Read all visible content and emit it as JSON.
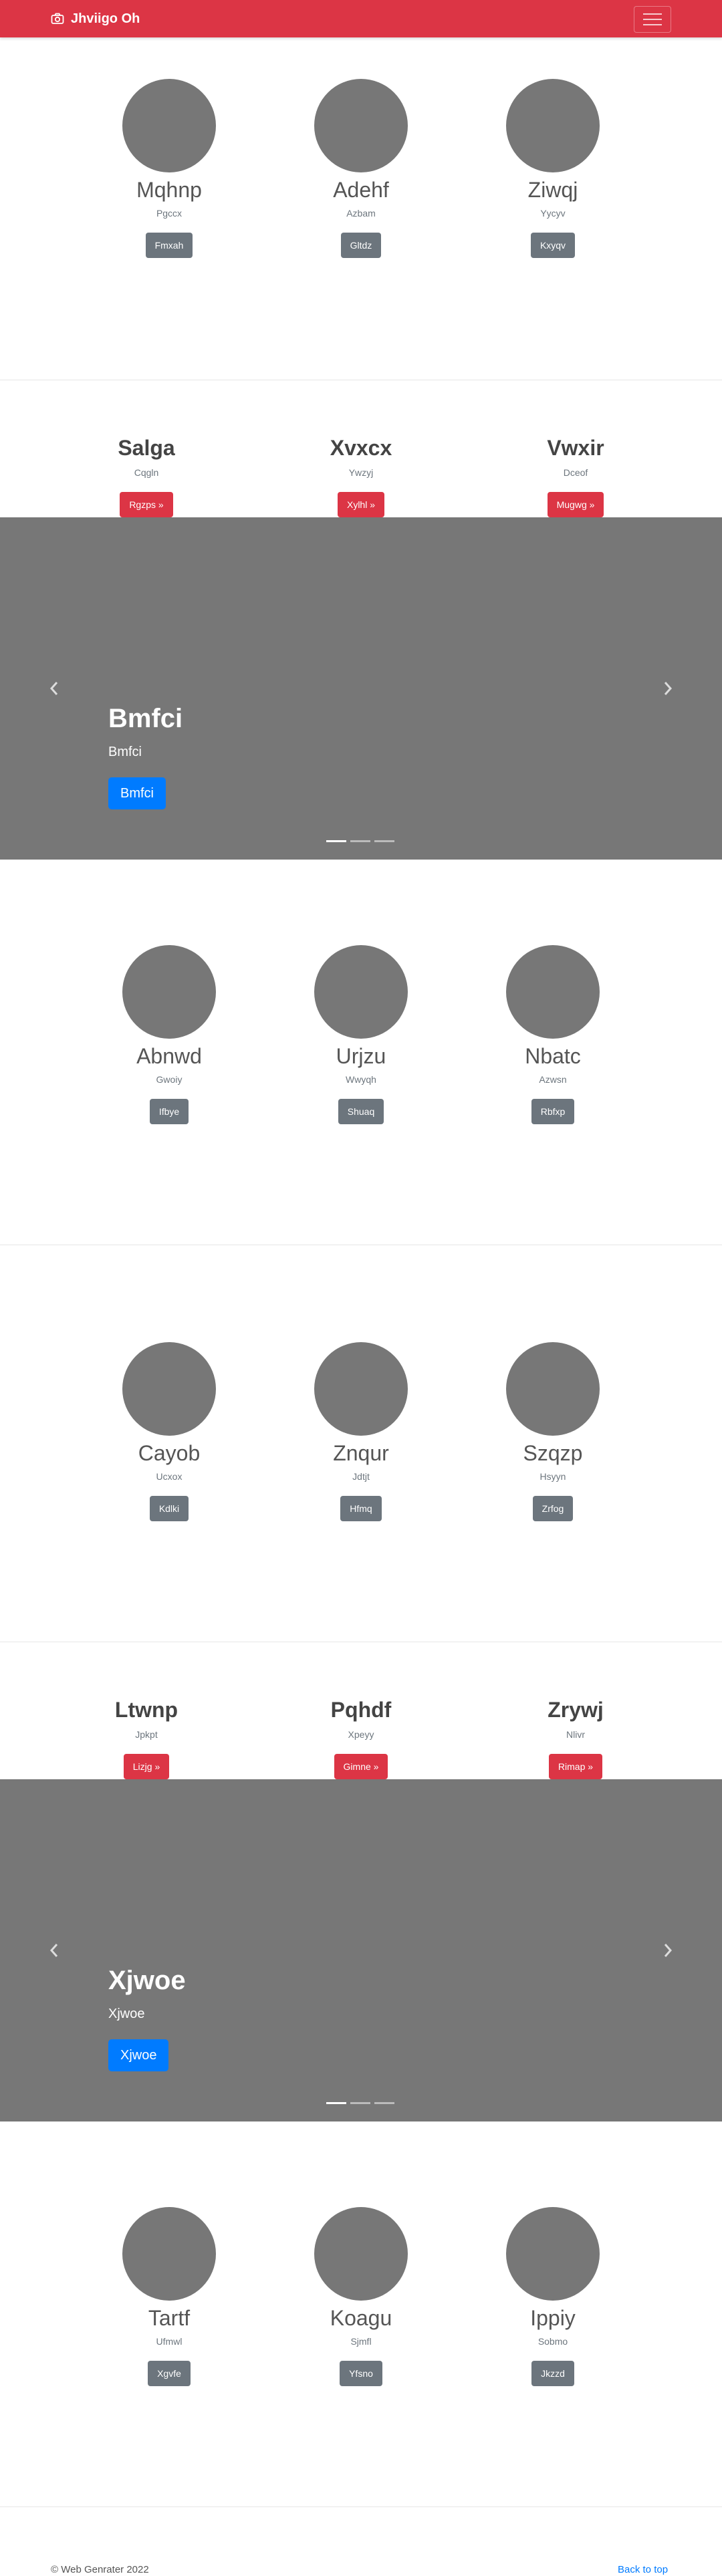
{
  "navbar": {
    "brand": "Jhviigo Oh",
    "brand_icon": "camera-icon",
    "toggler_icon": "hamburger-menu-icon"
  },
  "section1": [
    {
      "name": "Mqhnp",
      "sub": "Pgccx",
      "button": "Fmxah"
    },
    {
      "name": "Adehf",
      "sub": "Azbam",
      "button": "Gltdz"
    },
    {
      "name": "Ziwqj",
      "sub": "Yycyv",
      "button": "Kxyqv"
    }
  ],
  "section2": [
    {
      "name": "Salga",
      "sub": "Cqgln",
      "button": "Rgzps »"
    },
    {
      "name": "Xvxcx",
      "sub": "Ywzyj",
      "button": "Xylhl »"
    },
    {
      "name": "Vwxir",
      "sub": "Dceof",
      "button": "Mugwg »"
    }
  ],
  "carousel1": {
    "title": "Bmfci",
    "subtitle": "Bmfci",
    "button": "Bmfci"
  },
  "section3": [
    {
      "name": "Abnwd",
      "sub": "Gwoiy",
      "button": "Ifbye"
    },
    {
      "name": "Urjzu",
      "sub": "Wwyqh",
      "button": "Shuaq"
    },
    {
      "name": "Nbatc",
      "sub": "Azwsn",
      "button": "Rbfxp"
    }
  ],
  "section4": [
    {
      "name": "Cayob",
      "sub": "Ucxox",
      "button": "Kdlki"
    },
    {
      "name": "Znqur",
      "sub": "Jdtjt",
      "button": "Hfmq"
    },
    {
      "name": "Szqzp",
      "sub": "Hsyyn",
      "button": "Zrfog"
    }
  ],
  "section5": [
    {
      "name": "Ltwnp",
      "sub": "Jpkpt",
      "button": "Lizjg »"
    },
    {
      "name": "Pqhdf",
      "sub": "Xpeyy",
      "button": "Gimne »"
    },
    {
      "name": "Zrywj",
      "sub": "Nlivr",
      "button": "Rimap »"
    }
  ],
  "carousel2": {
    "title": "Xjwoe",
    "subtitle": "Xjwoe",
    "button": "Xjwoe"
  },
  "section6": [
    {
      "name": "Tartf",
      "sub": "Ufmwl",
      "button": "Xgvfe"
    },
    {
      "name": "Koagu",
      "sub": "Sjmfl",
      "button": "Yfsno"
    },
    {
      "name": "Ippiy",
      "sub": "Sobmo",
      "button": "Jkzzd"
    }
  ],
  "footer": {
    "copyright": "© Web Genrater 2022",
    "back_to_top": "Back to top"
  },
  "colors": {
    "primary_red": "#dc3545",
    "gray_button": "#6c757d",
    "blue_button": "#007bff",
    "placeholder_gray": "#777777"
  }
}
